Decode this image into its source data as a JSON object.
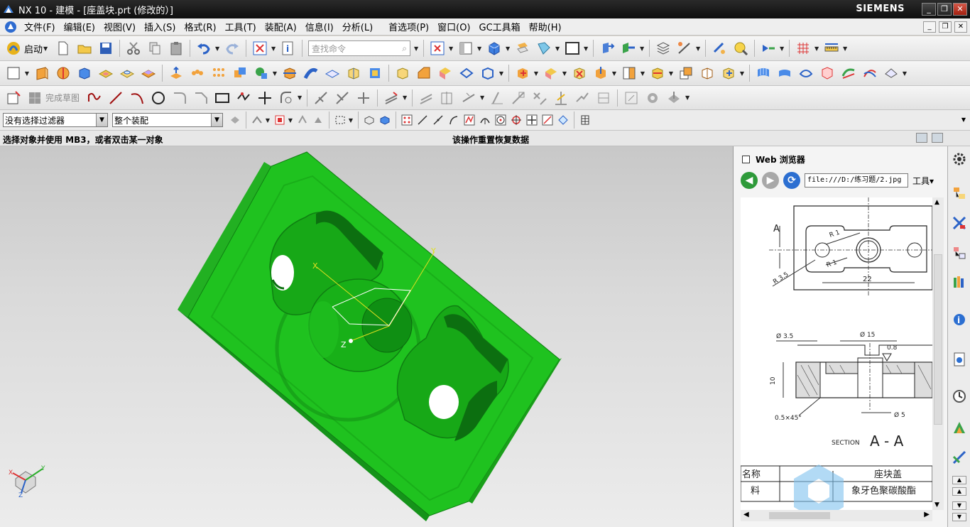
{
  "window": {
    "title": "NX 10 - 建模 - [座盖块.prt  (修改的）]",
    "brand": "SIEMENS",
    "controls": [
      "_",
      "❐",
      "✕"
    ]
  },
  "menu": {
    "items": [
      "文件(F)",
      "编辑(E)",
      "视图(V)",
      "插入(S)",
      "格式(R)",
      "工具(T)",
      "装配(A)",
      "信息(I)",
      "分析(L)",
      "首选项(P)",
      "窗口(O)",
      "GC工具箱",
      "帮助(H)"
    ],
    "doc_controls": [
      "_",
      "❐",
      "✕"
    ]
  },
  "toolbar": {
    "start_label": "启动",
    "search_placeholder": "查找命令",
    "finish_sketch_label": "完成草图"
  },
  "selection": {
    "filter_value": "没有选择过滤器",
    "scope_value": "整个装配"
  },
  "status": {
    "prompt": "选择对象并使用 MB3，或者双击某一对象",
    "message": "该操作重置恢复数据"
  },
  "viewport": {
    "csys_labels": {
      "x": "X",
      "y": "Y",
      "z": "Z"
    },
    "triad_labels": {
      "x": "X",
      "y": "Y",
      "z": "Z"
    },
    "model_color": "#1fc21f"
  },
  "web_browser": {
    "title": "Web 浏览器",
    "address": "file:///D:/练习题/2.jpg",
    "tools_label": "工具",
    "drawing": {
      "label_A": "A",
      "r1_top": "R 1",
      "r1_bottom": "R 1",
      "r35": "R 3.5",
      "dim_22": "22",
      "dim_phi35": "Ø 3.5",
      "dim_phi15": "Ø 15",
      "dim_08": "0.8",
      "dim_10": "10",
      "dim_05x45": "0.5×45°",
      "dim_phi5": "Ø 5",
      "section_word": "SECTION",
      "section_letters": "A - A",
      "table_name_label": "名称",
      "table_name_value": "座块盖",
      "table_material_label": "料",
      "table_material_value": "象牙色聚碳酸酯"
    }
  }
}
